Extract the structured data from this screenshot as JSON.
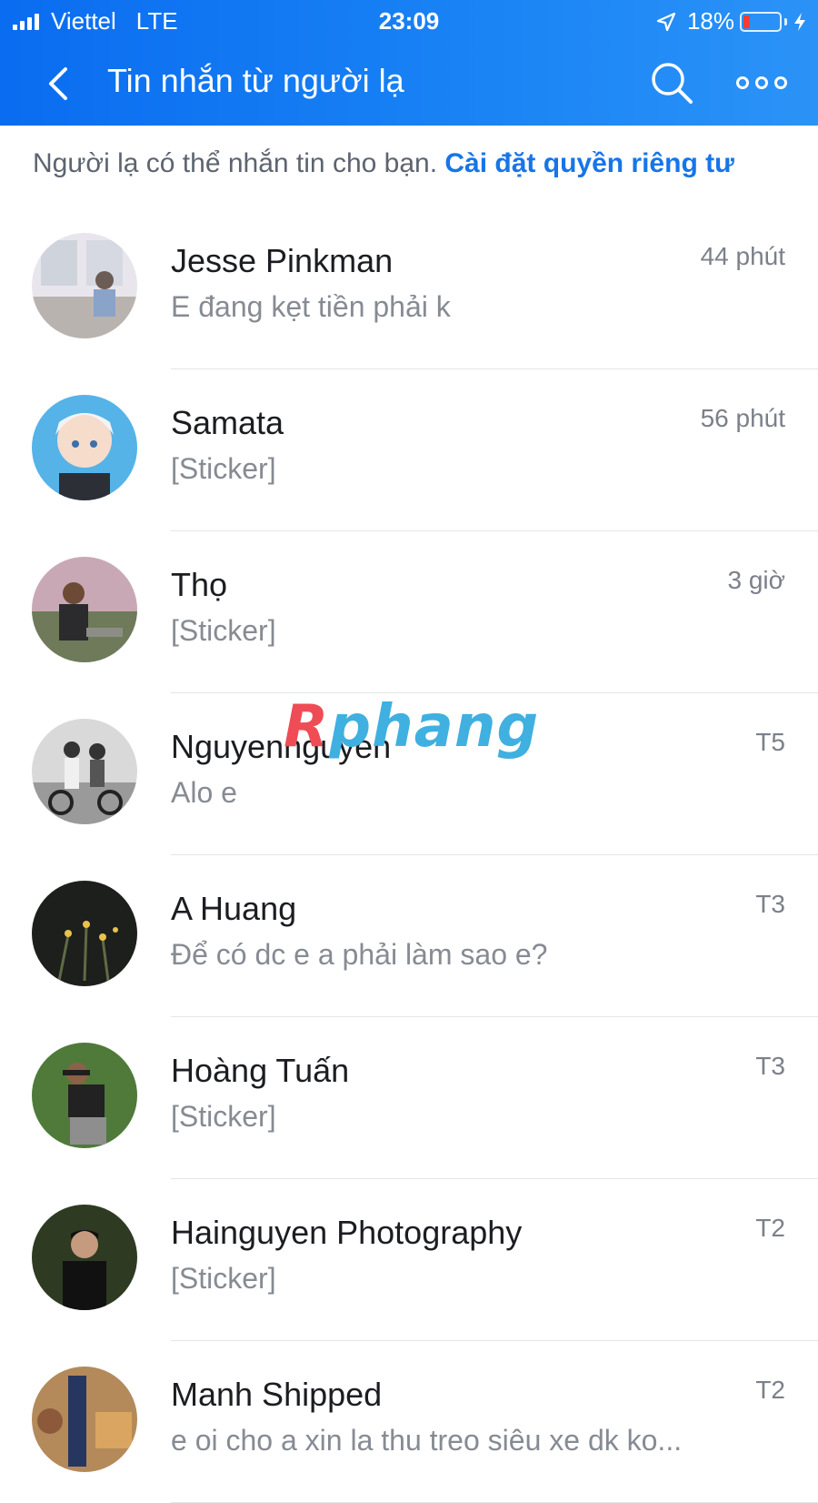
{
  "status_bar": {
    "carrier": "Viettel",
    "network": "LTE",
    "time": "23:09",
    "battery": "18%",
    "battery_level": 0.18,
    "icons": [
      "signal-icon",
      "location-arrow-icon",
      "battery-icon",
      "charging-bolt-icon"
    ]
  },
  "header": {
    "title": "Tin nhắn từ người lạ",
    "icons": [
      "back-chevron-icon",
      "search-icon",
      "more-icon"
    ],
    "background": "#1a84f5"
  },
  "notice": {
    "text": "Người lạ có thể nhắn tin cho bạn.",
    "link": "Cài đặt quyền riêng tư",
    "link_color": "#1775e8"
  },
  "conversations": [
    {
      "name": "Jesse Pinkman",
      "preview": "E đang kẹt tiền phải k",
      "time": "44 phút",
      "avatar": "avatar-jesse"
    },
    {
      "name": "Samata",
      "preview": "[Sticker]",
      "time": "56 phút",
      "avatar": "avatar-samata"
    },
    {
      "name": "Thọ",
      "preview": "[Sticker]",
      "time": "3 giờ",
      "avatar": "avatar-tho"
    },
    {
      "name": "Nguyennguyen",
      "preview": "Alo e",
      "time": "T5",
      "avatar": "avatar-nguyennguyen"
    },
    {
      "name": "A Huang",
      "preview": "Để có dc e a phải làm sao e?",
      "time": "T3",
      "avatar": "avatar-ahuang"
    },
    {
      "name": "Hoàng Tuấn",
      "preview": "[Sticker]",
      "time": "T3",
      "avatar": "avatar-hoangtuan"
    },
    {
      "name": "Hainguyen Photography",
      "preview": "[Sticker]",
      "time": "T2",
      "avatar": "avatar-hainguyen"
    },
    {
      "name": "Manh Shipped",
      "preview": "e oi cho a xin la thu treo siêu xe dk ko...",
      "time": "T2",
      "avatar": "avatar-manh"
    }
  ],
  "watermark": {
    "part1": "R",
    "part2": "phang"
  }
}
